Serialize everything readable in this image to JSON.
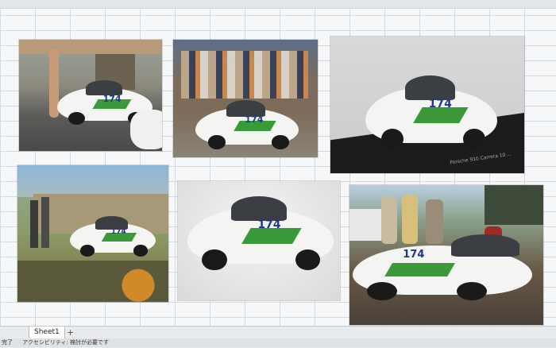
{
  "sheet": {
    "tab_label": "Sheet1",
    "add_label": "+"
  },
  "status": {
    "left_text": "完了",
    "accessibility_text": "アクセシビリティ: 検討が必要です"
  },
  "photos": [
    {
      "label": "photo-racing-paddock",
      "car_number": "174"
    },
    {
      "label": "photo-crowd-car",
      "car_number": "174"
    },
    {
      "label": "photo-model-car-dark-base",
      "car_number": "174",
      "plaque_text": "Porsche 910 Carrera 10 ..."
    },
    {
      "label": "photo-hillside-race",
      "car_number": "174"
    },
    {
      "label": "photo-model-car-studio",
      "car_number": "174"
    },
    {
      "label": "photo-drivers-with-car",
      "car_number": "174"
    }
  ]
}
